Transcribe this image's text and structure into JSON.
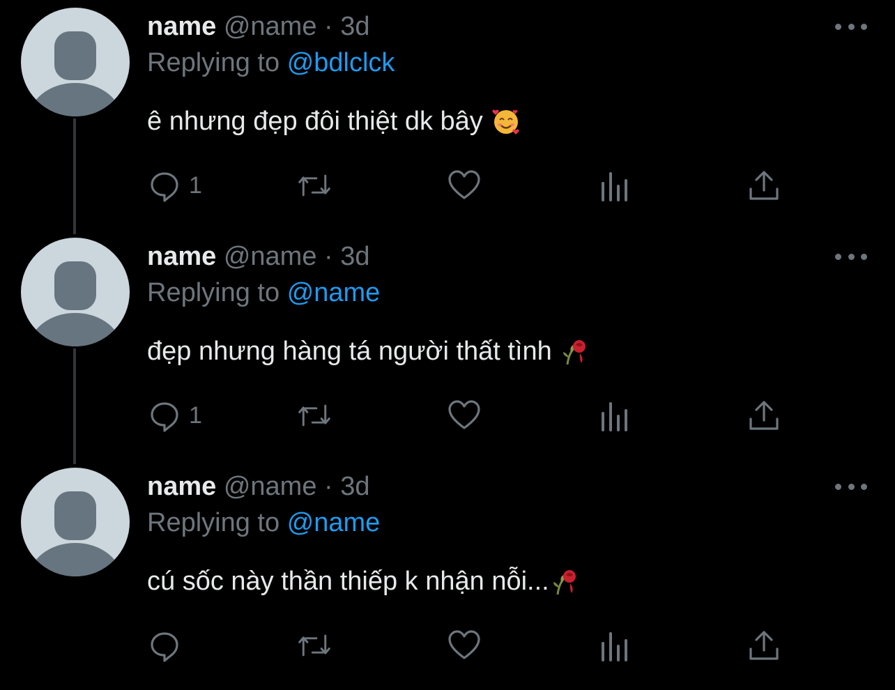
{
  "tweets": [
    {
      "name": "name",
      "handle": "@name",
      "separator": "·",
      "time": "3d",
      "replying_label": "Replying to",
      "replying_to": "@bdlclck",
      "text": "ê nhưng đẹp đôi thiệt dk bây",
      "emoji": "smiling-face-with-hearts-icon",
      "reply_count": "1",
      "retweet_count": "",
      "like_count": ""
    },
    {
      "name": "name",
      "handle": "@name",
      "separator": "·",
      "time": "3d",
      "replying_label": "Replying to",
      "replying_to": "@name",
      "text": "đẹp nhưng hàng tá người thất tình",
      "emoji": "wilted-flower-icon",
      "reply_count": "1",
      "retweet_count": "",
      "like_count": ""
    },
    {
      "name": "name",
      "handle": "@name",
      "separator": "·",
      "time": "3d",
      "replying_label": "Replying to",
      "replying_to": "@name",
      "text": "cú sốc này thần thiếp k nhận nỗi...",
      "emoji": "wilted-flower-icon",
      "reply_count": "",
      "retweet_count": "",
      "like_count": ""
    }
  ],
  "colors": {
    "background": "#000000",
    "text": "#e7e9ea",
    "muted": "#6e767d",
    "accent": "#1d9bf0",
    "avatar_bg": "#ccd6dd",
    "avatar_fg": "#66757f"
  }
}
